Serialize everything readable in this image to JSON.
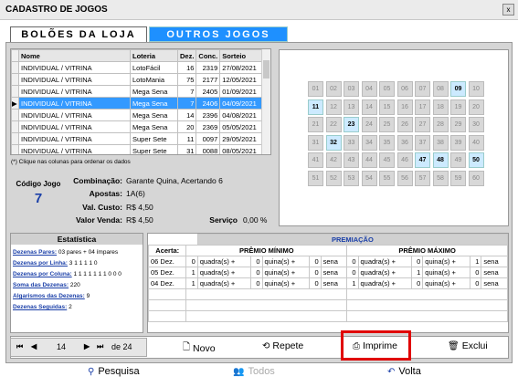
{
  "window": {
    "title": "CADASTRO DE JOGOS",
    "close": "x"
  },
  "tabs": [
    "BOLÕES DA LOJA",
    "OUTROS JOGOS"
  ],
  "grid": {
    "headers": [
      "Nome",
      "Loteria",
      "Dez.",
      "Conc.",
      "Sorteio"
    ],
    "rows": [
      [
        "INDIVIDUAL / VITRINA",
        "LotoFácil",
        "16",
        "2319",
        "27/08/2021"
      ],
      [
        "INDIVIDUAL / VITRINA",
        "LotoMania",
        "75",
        "2177",
        "12/05/2021"
      ],
      [
        "INDIVIDUAL / VITRINA",
        "Mega Sena",
        "7",
        "2405",
        "01/09/2021"
      ],
      [
        "INDIVIDUAL / VITRINA",
        "Mega Sena",
        "7",
        "2406",
        "04/09/2021"
      ],
      [
        "INDIVIDUAL / VITRINA",
        "Mega Sena",
        "14",
        "2396",
        "04/08/2021"
      ],
      [
        "INDIVIDUAL / VITRINA",
        "Mega Sena",
        "20",
        "2369",
        "05/05/2021"
      ],
      [
        "INDIVIDUAL / VITRINA",
        "Super Sete",
        "11",
        "0097",
        "29/05/2021"
      ],
      [
        "INDIVIDUAL / VITRINA",
        "Super Sete",
        "31",
        "0088",
        "08/05/2021"
      ]
    ],
    "selected_row": 3,
    "note": "(*) Clique nas colunas para ordenar os dados"
  },
  "info": {
    "code_label": "Código Jogo",
    "code_value": "7",
    "combinacao_label": "Combinação:",
    "combinacao_value": "Garante Quina, Acertando 6",
    "apostas_label": "Apostas:",
    "apostas_value": "1A(6)",
    "custo_label": "Val. Custo:",
    "custo_value": "R$ 4,50",
    "venda_label": "Valor Venda:",
    "venda_value": "R$ 4,50",
    "servico_label": "Serviço",
    "servico_value": "0,00 %"
  },
  "balls": {
    "numbers": [
      "01",
      "02",
      "03",
      "04",
      "05",
      "06",
      "07",
      "08",
      "09",
      "10",
      "11",
      "12",
      "13",
      "14",
      "15",
      "16",
      "17",
      "18",
      "19",
      "20",
      "21",
      "22",
      "23",
      "24",
      "25",
      "26",
      "27",
      "28",
      "29",
      "30",
      "31",
      "32",
      "33",
      "34",
      "35",
      "36",
      "37",
      "38",
      "39",
      "40",
      "41",
      "42",
      "43",
      "44",
      "45",
      "46",
      "47",
      "48",
      "49",
      "50",
      "51",
      "52",
      "53",
      "54",
      "55",
      "56",
      "57",
      "58",
      "59",
      "60"
    ],
    "selected": [
      "09",
      "11",
      "23",
      "32",
      "47",
      "48",
      "50"
    ]
  },
  "estatistica": {
    "title": "Estatística",
    "rows": [
      {
        "label": "Dezenas Pares:",
        "value": "03 pares + 04 ímpares"
      },
      {
        "label": "Dezenas por Linha:",
        "value": "3 1 1 1 1 0"
      },
      {
        "label": "Dezenas por Coluna:",
        "value": "1 1 1 1 1 1 1 0 0 0"
      },
      {
        "label": "Soma das Dezenas:",
        "value": "220"
      },
      {
        "label": "Algarismos das Dezenas:",
        "value": "9"
      },
      {
        "label": "Dezenas Seguidas:",
        "value": "2"
      }
    ]
  },
  "premiacao": {
    "title": "PREMIAÇÃO",
    "acerta": "Acerta:",
    "minimo": "PRÊMIO MÍNIMO",
    "maximo": "PRÊMIO MÁXIMO",
    "rows": [
      {
        "acerto": "06 Dez.",
        "min": [
          "0",
          "quadra(s) +",
          "0",
          "quina(s) +",
          "0",
          "sena"
        ],
        "max": [
          "0",
          "quadra(s) +",
          "0",
          "quina(s) +",
          "1",
          "sena"
        ]
      },
      {
        "acerto": "05 Dez.",
        "min": [
          "1",
          "quadra(s) +",
          "0",
          "quina(s) +",
          "0",
          "sena"
        ],
        "max": [
          "0",
          "quadra(s) +",
          "1",
          "quina(s) +",
          "0",
          "sena"
        ]
      },
      {
        "acerto": "04 Dez.",
        "min": [
          "1",
          "quadra(s) +",
          "0",
          "quina(s) +",
          "0",
          "sena"
        ],
        "max": [
          "1",
          "quadra(s) +",
          "0",
          "quina(s) +",
          "0",
          "sena"
        ]
      }
    ]
  },
  "nav": {
    "first": "⏮",
    "prev": "◀",
    "page": "14",
    "next": "▶",
    "last": "⏭",
    "of": "de 24"
  },
  "actions": {
    "novo": "Novo",
    "repete": "Repete",
    "imprime": "Imprime",
    "exclui": "Exclui"
  },
  "footer": {
    "pesquisa": "Pesquisa",
    "todos": "Todos",
    "volta": "Volta"
  }
}
